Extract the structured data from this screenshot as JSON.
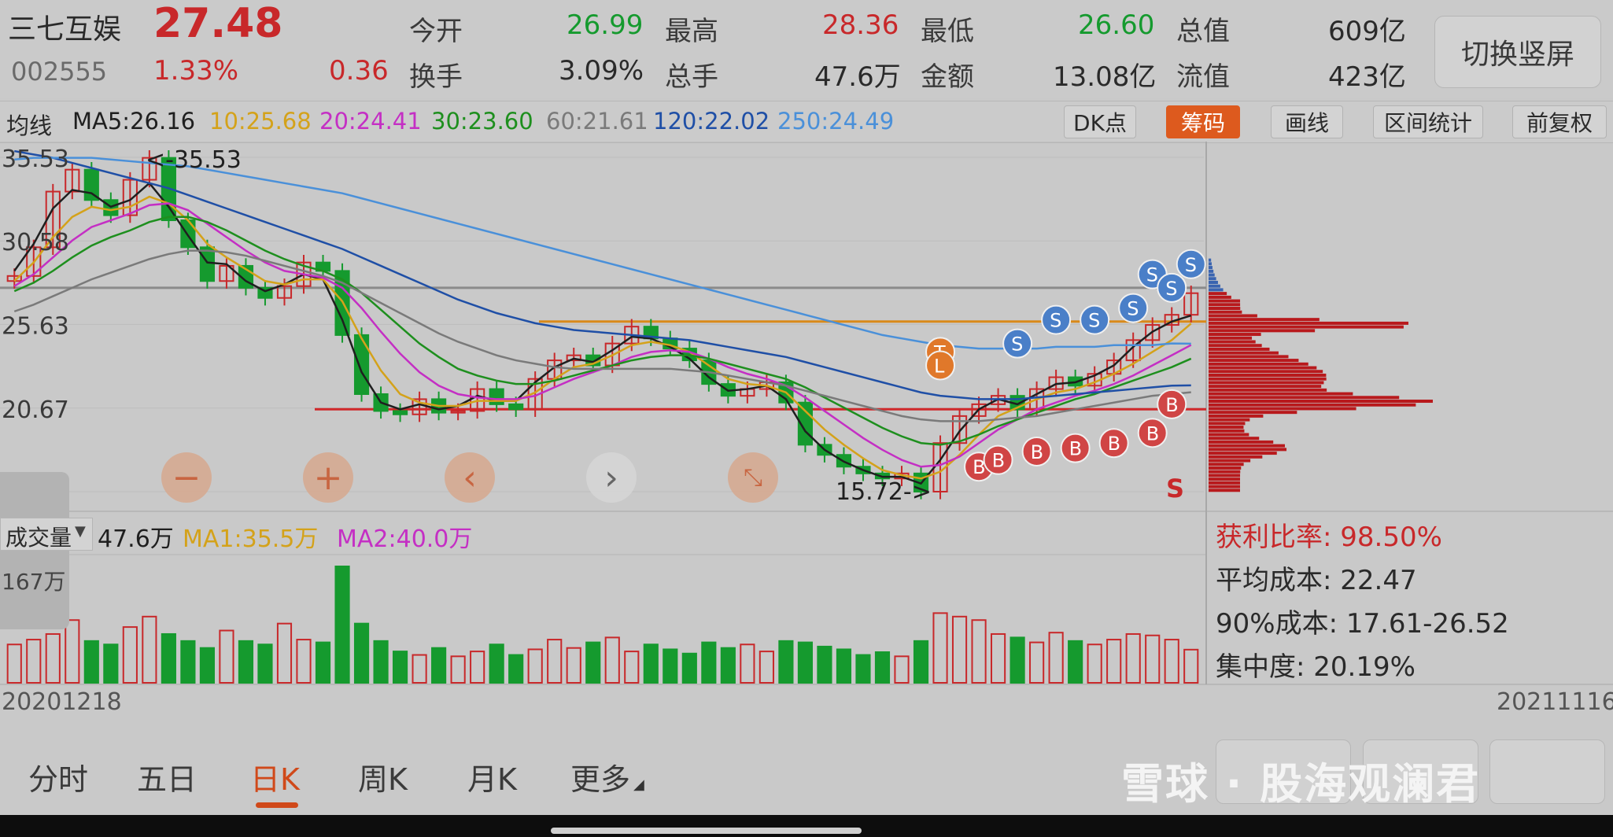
{
  "header": {
    "stock_name": "三七互娱",
    "price": "27.48",
    "code": "002555",
    "change_pct": "1.33%",
    "change_amt": "0.36",
    "open_label": "今开",
    "open_value": "26.99",
    "high_label": "最高",
    "high_value": "28.36",
    "low_label": "最低",
    "low_value": "26.60",
    "total_mv_label": "总值",
    "total_mv_value": "609亿",
    "turnover_label": "换手",
    "turnover_value": "3.09%",
    "volume_label": "总手",
    "volume_value": "47.6万",
    "amount_label": "金额",
    "amount_value": "13.08亿",
    "float_mv_label": "流值",
    "float_mv_value": "423亿",
    "portrait_button": "切换竖屏"
  },
  "ma_bar": {
    "title": "均线",
    "ma5": "MA5:26.16",
    "ma10": "10:25.68",
    "ma20": "20:24.41",
    "ma30": "30:23.60",
    "ma60": "60:21.61",
    "ma120": "120:22.02",
    "ma250": "250:24.49"
  },
  "tools": {
    "dk": "DK点",
    "chips": "筹码",
    "draw": "画线",
    "range_stats": "区间统计",
    "adjust": "前复权"
  },
  "colors": {
    "up": "#c8282a",
    "down": "#159a2e",
    "ma5": "#1f1f1f",
    "ma10": "#d4a21a",
    "ma20": "#c42fc4",
    "ma30": "#1e8f1e",
    "ma60": "#7a7a7a",
    "ma120": "#1f4fa6",
    "ma250": "#4a90d9",
    "accent": "#d0491a"
  },
  "chart_data": {
    "type": "candlestick",
    "x_start": "20201218",
    "x_end": "20211116",
    "y_ticks": [
      "35.53",
      "30.58",
      "25.63",
      "20.67",
      "15.72"
    ],
    "ylim": [
      15.72,
      35.53
    ],
    "annotations": {
      "high_mark": "<-35.53",
      "low_mark": "15.72->",
      "s_mark": "S"
    },
    "price_closes": [
      28.5,
      30.2,
      33.5,
      34.8,
      33.0,
      32.1,
      34.2,
      35.5,
      31.8,
      30.2,
      28.2,
      29.1,
      27.8,
      27.2,
      27.9,
      29.3,
      28.8,
      25.0,
      21.5,
      20.5,
      20.3,
      21.2,
      20.4,
      20.5,
      21.8,
      20.9,
      20.6,
      22.4,
      23.5,
      23.8,
      23.2,
      24.5,
      25.5,
      24.8,
      24.2,
      23.5,
      22.1,
      21.4,
      21.8,
      22.2,
      21.0,
      18.5,
      17.9,
      17.2,
      16.8,
      16.5,
      16.8,
      15.72,
      18.6,
      20.2,
      20.9,
      21.4,
      20.6,
      21.8,
      22.5,
      22.0,
      22.7,
      23.5,
      24.7,
      25.6,
      26.2,
      27.48
    ],
    "ma_lines": {
      "ma5": [
        28.8,
        30.4,
        32.5,
        33.6,
        33.4,
        32.6,
        33.0,
        34.0,
        32.6,
        30.9,
        29.3,
        29.2,
        28.2,
        27.6,
        28.0,
        28.6,
        28.3,
        25.9,
        22.8,
        21.0,
        20.6,
        20.9,
        20.6,
        20.8,
        21.4,
        21.1,
        21.1,
        22.2,
        23.1,
        23.6,
        23.4,
        24.1,
        24.9,
        24.8,
        24.3,
        23.6,
        22.5,
        21.7,
        21.8,
        22.0,
        21.2,
        19.3,
        18.2,
        17.5,
        17.0,
        16.6,
        16.6,
        16.2,
        17.6,
        19.3,
        20.6,
        21.2,
        20.9,
        21.5,
        22.1,
        22.2,
        22.6,
        23.2,
        24.3,
        25.2,
        25.8,
        26.16
      ],
      "ma10": [
        28.2,
        29.3,
        30.8,
        32.0,
        32.6,
        32.4,
        32.6,
        33.2,
        32.8,
        31.8,
        30.4,
        29.6,
        28.9,
        28.2,
        28.0,
        28.3,
        28.3,
        27.0,
        24.8,
        22.9,
        21.5,
        21.0,
        20.8,
        20.8,
        21.1,
        21.1,
        21.1,
        21.6,
        22.4,
        23.1,
        23.3,
        23.8,
        24.4,
        24.6,
        24.4,
        24.0,
        23.2,
        22.4,
        22.1,
        22.0,
        21.6,
        20.5,
        19.4,
        18.5,
        17.7,
        17.0,
        16.7,
        16.5,
        16.9,
        17.9,
        19.1,
        20.2,
        20.7,
        21.2,
        21.6,
        21.8,
        22.2,
        22.7,
        23.3,
        24.0,
        24.7,
        25.68
      ],
      "ma20": [
        27.9,
        28.6,
        29.6,
        30.6,
        31.4,
        31.8,
        32.2,
        32.7,
        32.8,
        32.4,
        31.6,
        30.8,
        30.0,
        29.3,
        28.8,
        28.6,
        28.4,
        27.8,
        26.6,
        25.2,
        23.9,
        22.8,
        22.0,
        21.5,
        21.3,
        21.2,
        21.2,
        21.4,
        21.9,
        22.4,
        22.8,
        23.2,
        23.7,
        24.0,
        24.1,
        24.0,
        23.6,
        23.1,
        22.7,
        22.4,
        22.0,
        21.3,
        20.5,
        19.7,
        18.9,
        18.2,
        17.6,
        17.2,
        17.3,
        17.8,
        18.6,
        19.4,
        20.0,
        20.6,
        21.0,
        21.4,
        21.7,
        22.1,
        22.6,
        23.2,
        23.8,
        24.41
      ],
      "ma30": [
        27.6,
        28.1,
        28.8,
        29.6,
        30.3,
        30.8,
        31.2,
        31.7,
        32.0,
        32.0,
        31.7,
        31.2,
        30.6,
        30.0,
        29.5,
        29.1,
        28.8,
        28.3,
        27.5,
        26.5,
        25.5,
        24.5,
        23.7,
        23.0,
        22.6,
        22.3,
        22.1,
        22.1,
        22.3,
        22.6,
        22.9,
        23.2,
        23.5,
        23.7,
        23.8,
        23.8,
        23.6,
        23.3,
        23.0,
        22.7,
        22.4,
        21.9,
        21.3,
        20.7,
        20.1,
        19.5,
        19.0,
        18.6,
        18.5,
        18.7,
        19.1,
        19.6,
        20.0,
        20.4,
        20.8,
        21.2,
        21.5,
        21.9,
        22.3,
        22.7,
        23.1,
        23.6
      ],
      "ma60": [
        26.4,
        26.8,
        27.3,
        27.8,
        28.3,
        28.7,
        29.1,
        29.5,
        29.8,
        30.0,
        30.0,
        29.9,
        29.7,
        29.4,
        29.1,
        28.8,
        28.5,
        28.1,
        27.5,
        26.9,
        26.3,
        25.7,
        25.1,
        24.6,
        24.2,
        23.8,
        23.5,
        23.3,
        23.1,
        23.0,
        23.0,
        23.0,
        23.0,
        23.0,
        23.0,
        22.9,
        22.8,
        22.6,
        22.4,
        22.2,
        22.0,
        21.7,
        21.4,
        21.1,
        20.8,
        20.5,
        20.2,
        20.0,
        19.9,
        19.9,
        19.9,
        20.0,
        20.1,
        20.2,
        20.4,
        20.6,
        20.8,
        21.0,
        21.2,
        21.4,
        21.5,
        21.61
      ],
      "ma120": [
        35.9,
        35.7,
        35.5,
        35.2,
        34.9,
        34.6,
        34.3,
        34.0,
        33.7,
        33.3,
        32.9,
        32.5,
        32.1,
        31.7,
        31.3,
        30.9,
        30.5,
        30.1,
        29.6,
        29.1,
        28.6,
        28.1,
        27.6,
        27.1,
        26.7,
        26.3,
        26.0,
        25.7,
        25.5,
        25.3,
        25.2,
        25.1,
        25.0,
        24.9,
        24.8,
        24.7,
        24.5,
        24.3,
        24.1,
        23.9,
        23.7,
        23.4,
        23.1,
        22.8,
        22.5,
        22.2,
        21.9,
        21.6,
        21.4,
        21.3,
        21.2,
        21.2,
        21.2,
        21.3,
        21.4,
        21.5,
        21.6,
        21.7,
        21.8,
        21.9,
        22.0,
        22.02
      ],
      "ma250": [
        35.4,
        35.5,
        35.5,
        35.5,
        35.5,
        35.4,
        35.3,
        35.2,
        35.1,
        35.0,
        34.8,
        34.6,
        34.4,
        34.2,
        34.0,
        33.8,
        33.6,
        33.4,
        33.1,
        32.8,
        32.5,
        32.2,
        31.9,
        31.6,
        31.3,
        31.0,
        30.7,
        30.4,
        30.1,
        29.8,
        29.5,
        29.2,
        28.9,
        28.6,
        28.3,
        28.0,
        27.7,
        27.4,
        27.1,
        26.8,
        26.5,
        26.2,
        25.9,
        25.6,
        25.3,
        25.0,
        24.8,
        24.6,
        24.4,
        24.3,
        24.2,
        24.2,
        24.2,
        24.2,
        24.3,
        24.3,
        24.3,
        24.4,
        24.4,
        24.4,
        24.5,
        24.49
      ]
    },
    "horizontal_lines": [
      {
        "name": "orange-resistance",
        "y": 25.8,
        "color": "#d98a1a"
      },
      {
        "name": "red-support",
        "y": 20.6,
        "color": "#d0282a"
      },
      {
        "name": "gray-level",
        "y": 27.8,
        "color": "#8a8a8a"
      }
    ],
    "volume": {
      "title": "成交量",
      "current": "47.6万",
      "ma1": "MA1:35.5万",
      "ma2": "MA2:40.0万",
      "max_label": "167万",
      "values": [
        55,
        62,
        70,
        90,
        60,
        55,
        80,
        95,
        70,
        60,
        50,
        75,
        60,
        55,
        85,
        62,
        58,
        167,
        85,
        60,
        45,
        40,
        50,
        38,
        45,
        55,
        40,
        48,
        62,
        50,
        58,
        65,
        45,
        55,
        48,
        42,
        58,
        50,
        55,
        45,
        60,
        58,
        52,
        48,
        40,
        44,
        38,
        60,
        100,
        95,
        90,
        70,
        65,
        58,
        72,
        60,
        55,
        62,
        70,
        68,
        62,
        47.6
      ]
    }
  },
  "chip_stats": {
    "profit_ratio": "获利比率: 98.50%",
    "avg_cost": "平均成本: 22.47",
    "cost_90": "90%成本:  17.61-26.52",
    "concentration": "集中度: 20.19%"
  },
  "tabs": [
    "分时",
    "五日",
    "日K",
    "周K",
    "月K",
    "更多"
  ],
  "active_tab": "日K",
  "watermark": "雪球 · 股海观澜君"
}
